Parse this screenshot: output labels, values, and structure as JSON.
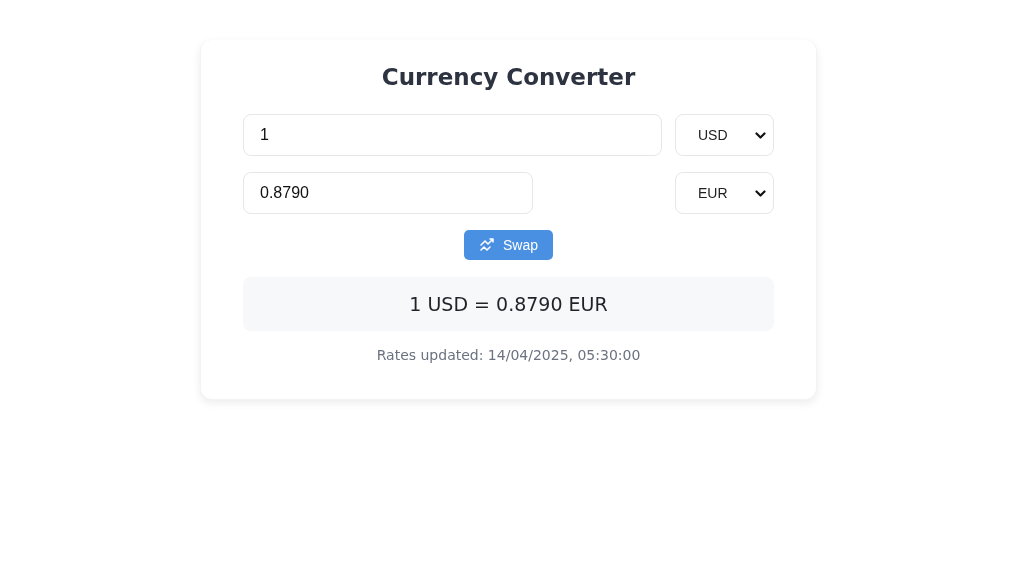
{
  "title": "Currency Converter",
  "from": {
    "amount": "1",
    "currency": "USD"
  },
  "to": {
    "amount": "0.8790",
    "currency": "EUR"
  },
  "swap_button": {
    "label": "Swap"
  },
  "result": "1 USD = 0.8790 EUR",
  "updated": "Rates updated: 14/04/2025, 05:30:00"
}
